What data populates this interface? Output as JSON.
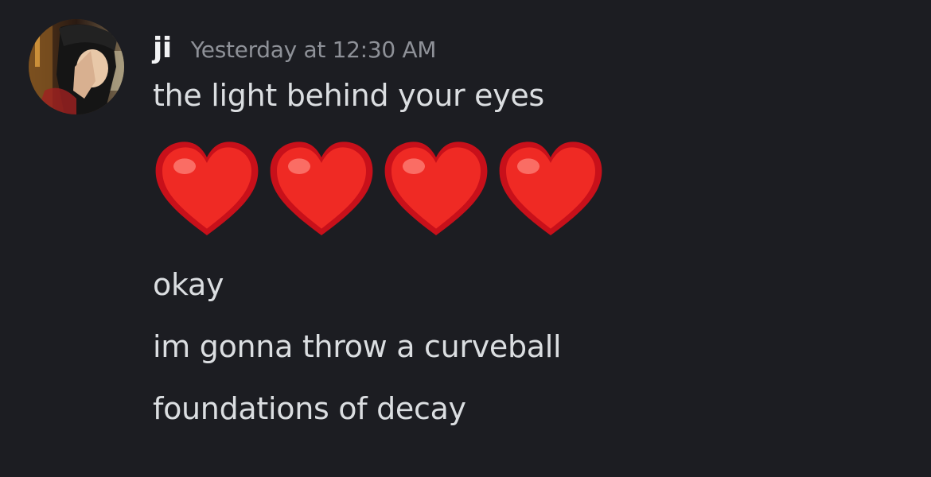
{
  "message": {
    "author": "ji",
    "timestamp": "Yesterday at 12:30 AM",
    "avatar_icon": "user-avatar",
    "lines": [
      "the light behind your eyes",
      "okay",
      "im gonna throw a curveball",
      "foundations of decay"
    ],
    "emoji": [
      "❤️",
      "❤️",
      "❤️",
      "❤️"
    ],
    "emoji_icon": "red-heart-icon"
  },
  "colors": {
    "background": "#1c1d22",
    "username": "#f2f3f5",
    "timestamp": "#8e9198",
    "message_text": "#dbdee1",
    "heart": "#e8201e"
  }
}
